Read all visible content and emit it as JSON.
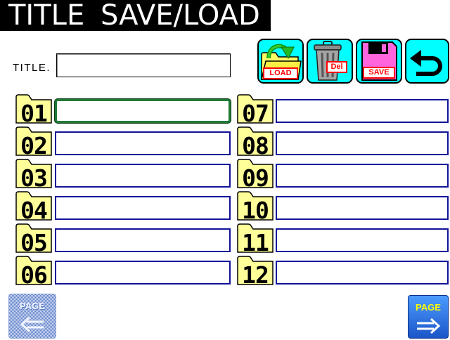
{
  "window": {
    "title": "TITLE SAVE/LOAD"
  },
  "title_field": {
    "label": "TITLE.",
    "value": ""
  },
  "toolbar": {
    "load": {
      "label": "LOAD",
      "icon": "folder-load-icon"
    },
    "delete": {
      "label": "Del",
      "icon": "trash-can-icon"
    },
    "save": {
      "label": "SAVE",
      "icon": "floppy-disk-icon"
    },
    "back": {
      "icon": "return-arrow-icon"
    }
  },
  "slots": [
    {
      "number": "01",
      "title": "",
      "selected": true
    },
    {
      "number": "02",
      "title": ""
    },
    {
      "number": "03",
      "title": ""
    },
    {
      "number": "04",
      "title": ""
    },
    {
      "number": "05",
      "title": ""
    },
    {
      "number": "06",
      "title": ""
    },
    {
      "number": "07",
      "title": ""
    },
    {
      "number": "08",
      "title": ""
    },
    {
      "number": "09",
      "title": ""
    },
    {
      "number": "10",
      "title": ""
    },
    {
      "number": "11",
      "title": ""
    },
    {
      "number": "12",
      "title": ""
    }
  ],
  "pager": {
    "prev": {
      "label": "PAGE",
      "icon": "double-arrow-left-icon",
      "enabled": false
    },
    "next": {
      "label": "PAGE",
      "icon": "double-arrow-right-icon",
      "enabled": true
    }
  },
  "colors": {
    "header_bg": "#000000",
    "header_text": "#ffffff",
    "toolbar_button_bg": "#00ffff",
    "label_red": "#ff0000",
    "slot_tab_bg": "#ffff99",
    "slot_field_border": "#12129a",
    "slot_selected_border": "#1f7a36",
    "page_button_bg": "#1a55c8",
    "page_label": "#ffff00"
  }
}
